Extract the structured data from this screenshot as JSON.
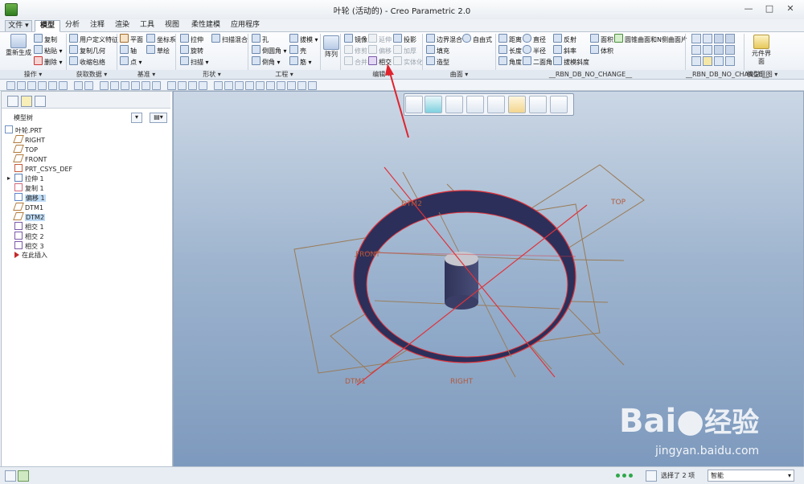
{
  "window": {
    "title": "叶轮 (活动的) - Creo Parametric 2.0",
    "controls": [
      "—",
      "□",
      "✕"
    ]
  },
  "tabs": [
    {
      "label": "文件"
    },
    {
      "label": "模型"
    },
    {
      "label": "分析"
    },
    {
      "label": "注释"
    },
    {
      "label": "渲染"
    },
    {
      "label": "工具"
    },
    {
      "label": "视图"
    },
    {
      "label": "柔性建模"
    },
    {
      "label": "应用程序"
    }
  ],
  "ribbon": {
    "operations": {
      "regenerate": "重新生成",
      "copy": "复制",
      "paste": "粘贴",
      "delete": "删除"
    },
    "get_data": {
      "udf": "用户定义特征",
      "copy_geom": "复制几何",
      "shrinkwrap": "收缩包络"
    },
    "datum": {
      "plane": "平面",
      "csys": "坐标系",
      "axis": "轴",
      "sketch": "草绘",
      "point": "点"
    },
    "shapes": {
      "extrude": "拉伸",
      "sweep_blend": "扫描混合",
      "revolve": "旋转",
      "sweep": "扫描"
    },
    "engineering": {
      "hole": "孔",
      "draft": "拔模",
      "round": "倒圆角",
      "shell": "壳",
      "chamfer": "倒角",
      "rib": "筋"
    },
    "pattern": "阵列",
    "editing": {
      "mirror": "镜像",
      "extend": "延伸",
      "project": "投影",
      "trim": "修剪",
      "offset": "偏移",
      "thicken": "加厚",
      "merge": "合并",
      "intersect": "相交",
      "solidify": "实体化"
    },
    "surfaces": {
      "boundary_blend": "边界混合",
      "freestyle": "自由式",
      "fill": "填充",
      "style": "造型"
    },
    "measure": {
      "distance": "距离",
      "diameter": "直径",
      "reflection": "反射",
      "area": "面积",
      "curvature_surface": "圆锥曲面和N侧曲面片",
      "length": "长度",
      "radius": "半径",
      "slope": "斜率",
      "volume": "体积",
      "angle": "角度",
      "dihedral": "二面角",
      "draft_slope": "拔模斜度"
    },
    "component_ui": "元件界面",
    "group_labels": {
      "operations": "操作",
      "get_data": "获取数据",
      "datum": "基准",
      "shapes": "形状",
      "engineering": "工程",
      "editing": "编辑",
      "surfaces": "曲面",
      "rbn1": "__RBN_DB_NO_CHANGE__",
      "rbn2": "__RBN_DB_NO_CHANGE__",
      "model_intent": "模型意图"
    }
  },
  "model_tree": {
    "tab_label": "模型树",
    "items": [
      {
        "label": "叶轮.PRT",
        "icon": "part-icon"
      },
      {
        "label": "RIGHT",
        "icon": "datum-plane-icon"
      },
      {
        "label": "TOP",
        "icon": "datum-plane-icon"
      },
      {
        "label": "FRONT",
        "icon": "datum-plane-icon"
      },
      {
        "label": "PRT_CSYS_DEF",
        "icon": "csys-icon"
      },
      {
        "label": "拉伸 1",
        "icon": "extrude-icon"
      },
      {
        "label": "复制 1",
        "icon": "copy-surface-icon"
      },
      {
        "label": "偏移 1",
        "icon": "offset-icon"
      },
      {
        "label": "DTM1",
        "icon": "datum-plane-icon"
      },
      {
        "label": "DTM2",
        "icon": "datum-plane-icon"
      },
      {
        "label": "相交 1",
        "icon": "intersect-icon"
      },
      {
        "label": "相交 2",
        "icon": "intersect-icon"
      },
      {
        "label": "相交 3",
        "icon": "intersect-icon"
      },
      {
        "label": "在此插入",
        "icon": "insert-here-icon"
      }
    ]
  },
  "viewport": {
    "labels": {
      "dtm2": "DTM2",
      "top": "TOP",
      "front": "FRONT",
      "dtm1": "DTM1",
      "right": "RIGHT"
    }
  },
  "status": {
    "selected": "选择了 2 项",
    "filter": "智能"
  },
  "watermark": {
    "brand": "Bai",
    "brand2": "经验",
    "url": "jingyan.baidu.com"
  },
  "colors": {
    "accent": "#3a6ea5",
    "feature_red": "#e0323a",
    "datum_brown": "#9a7a55",
    "solid_navy": "#2c2f5a"
  }
}
